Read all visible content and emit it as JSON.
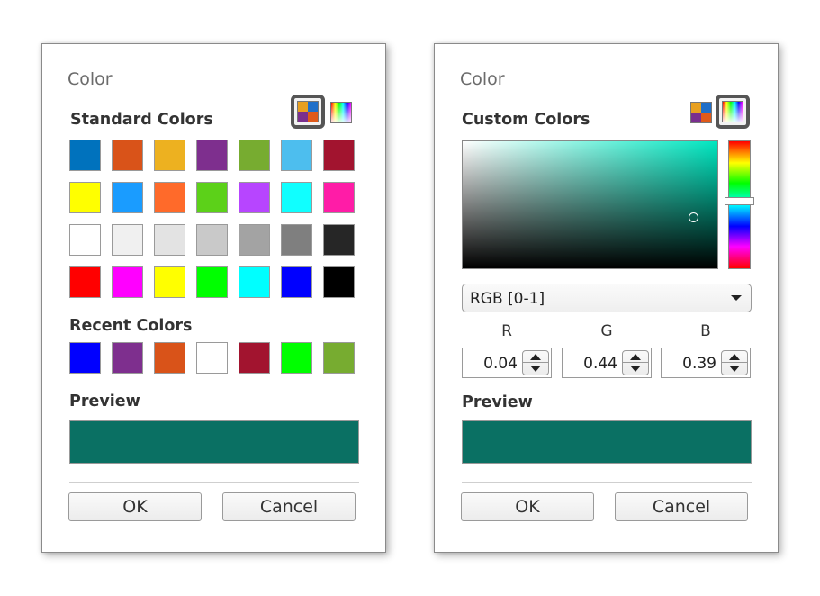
{
  "left_dialog": {
    "title": "Color",
    "standard_label": "Standard Colors",
    "mode_icons": [
      "standard-palette-icon",
      "custom-gradient-icon"
    ],
    "standard_colors": [
      [
        "#0072BD",
        "#D95319",
        "#EDB120",
        "#7E2F8E",
        "#77AC30",
        "#4DBEEE",
        "#A2142F"
      ],
      [
        "#FFFF00",
        "#1A9CFF",
        "#FF6A2A",
        "#5CD119",
        "#B745FF",
        "#10FFFF",
        "#FF1CA7"
      ],
      [
        "#FFFFFF",
        "#F0F0F0",
        "#E3E3E3",
        "#C9C9C9",
        "#A3A3A3",
        "#7F7F7F",
        "#262626"
      ],
      [
        "#FF0000",
        "#FF00FF",
        "#FFFF00",
        "#00FF00",
        "#00FFFF",
        "#0000FF",
        "#000000"
      ]
    ],
    "recent_label": "Recent Colors",
    "recent_colors": [
      "#0000FF",
      "#7E2F8E",
      "#D95319",
      "#FFFFFF",
      "#A2142F",
      "#00FF00",
      "#77AC30"
    ],
    "preview_label": "Preview",
    "preview_color": "#0A7063",
    "ok_label": "OK",
    "cancel_label": "Cancel"
  },
  "right_dialog": {
    "title": "Color",
    "custom_label": "Custom Colors",
    "mode_select": "RGB [0-1]",
    "channels": [
      {
        "label": "R",
        "value": "0.04"
      },
      {
        "label": "G",
        "value": "0.44"
      },
      {
        "label": "B",
        "value": "0.39"
      }
    ],
    "preview_label": "Preview",
    "preview_color": "#0A7063",
    "ok_label": "OK",
    "cancel_label": "Cancel"
  }
}
